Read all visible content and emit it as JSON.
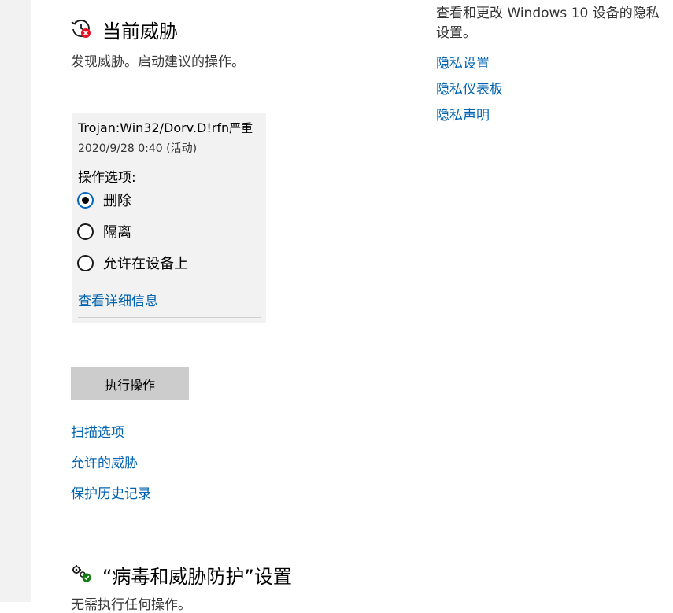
{
  "current_threats": {
    "title": "当前威胁",
    "subtitle": "发现威胁。启动建议的操作。",
    "icon": "threat-history-icon"
  },
  "threat": {
    "name": "Trojan:Win32/Dorv.D!rfn",
    "severity": "严重",
    "date": "2020/9/28 0:40 (活动)",
    "options_label": "操作选项:",
    "options": [
      {
        "label": "删除",
        "selected": true
      },
      {
        "label": "隔离",
        "selected": false
      },
      {
        "label": "允许在设备上",
        "selected": false
      }
    ],
    "details_link": "查看详细信息"
  },
  "action_button": "执行操作",
  "links": [
    "扫描选项",
    "允许的威胁",
    "保护历史记录"
  ],
  "settings_section": {
    "title": "“病毒和威胁防护”设置",
    "subtitle": "无需执行任何操作。",
    "icon": "settings-gear-check-icon"
  },
  "privacy": {
    "description": "查看和更改 Windows 10 设备的隐私设置。",
    "links": [
      "隐私设置",
      "隐私仪表板",
      "隐私声明"
    ]
  },
  "colors": {
    "link": "#0063b1",
    "radio_selected_border": "#0067c0",
    "error_badge": "#e81123",
    "success_badge": "#107c10",
    "card_background": "#f2f2f2",
    "button_background": "#cccccc"
  }
}
